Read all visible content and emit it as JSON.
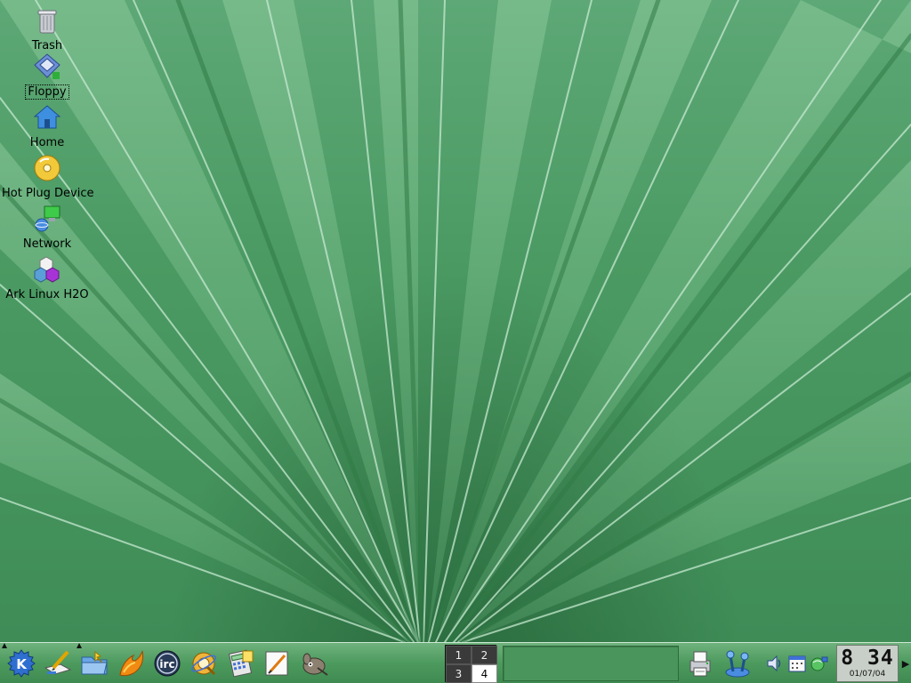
{
  "desktop_icons": [
    {
      "label": "Trash",
      "icon": "trash-icon"
    },
    {
      "label": "Floppy",
      "icon": "floppy-icon",
      "selected": true
    },
    {
      "label": "Home",
      "icon": "home-icon"
    },
    {
      "label": "Hot Plug Device",
      "icon": "cdrom-icon"
    },
    {
      "label": "Network",
      "icon": "network-icon"
    },
    {
      "label": "Ark Linux H2O",
      "icon": "ark-linux-icon"
    }
  ],
  "panel": {
    "quick_launch": [
      "kde-menu-icon",
      "text-editor-icon",
      "file-manager-icon",
      "firefox-icon",
      "irc-icon",
      "quanta-icon",
      "calculator-icon",
      "drawing-icon",
      "gimp-icon"
    ],
    "pager": {
      "desktops": [
        "1",
        "2",
        "3",
        "4"
      ],
      "active": "4"
    },
    "system_buttons": [
      "printer-icon",
      "control-center-icon"
    ],
    "tray": [
      "volume-icon",
      "calendar-icon",
      "network-status-icon"
    ],
    "clock": {
      "time": "8 34",
      "date": "01/07/04"
    }
  },
  "colors": {
    "wallpaper": "#4b9a63",
    "panel": "#4d9a5e",
    "clock_bg": "#c8cfc8"
  }
}
